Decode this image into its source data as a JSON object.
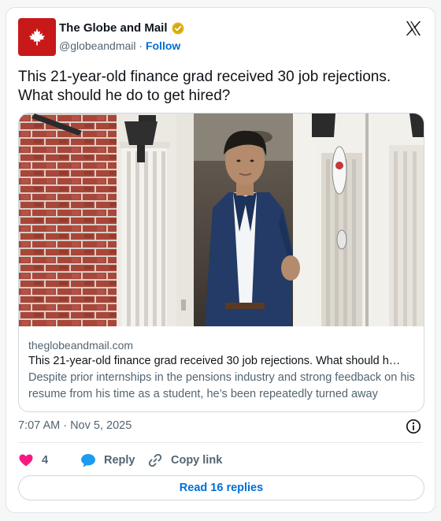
{
  "author": {
    "display_name": "The Globe and Mail",
    "handle": "@globeandmail",
    "separator": "·",
    "follow_label": "Follow"
  },
  "post": {
    "text": "This 21-year-old finance grad received 30 job rejections. What should he do to get hired?"
  },
  "link_card": {
    "domain": "theglobeandmail.com",
    "title": "This 21-year-old finance grad received 30 job rejections. What should h…",
    "description": "Despite prior internships in the pensions industry and strong feedback on his resume from his time as a student, he’s been repeatedly turned away"
  },
  "meta": {
    "timestamp": "7:07 AM · Nov 5, 2025"
  },
  "actions": {
    "like_count": "4",
    "reply_label": "Reply",
    "copy_link_label": "Copy link"
  },
  "footer": {
    "read_replies_label": "Read 16 replies"
  },
  "colors": {
    "brand_red": "#c8191a",
    "link_blue": "#006fd6",
    "like_pink": "#f91880",
    "reply_blue": "#1d9bf0",
    "verified_gold": "#e2b719"
  },
  "icons": [
    "maple-leaf-logo",
    "verified-badge-icon",
    "x-logo-icon",
    "info-icon",
    "heart-icon",
    "reply-bubble-icon",
    "link-icon"
  ]
}
